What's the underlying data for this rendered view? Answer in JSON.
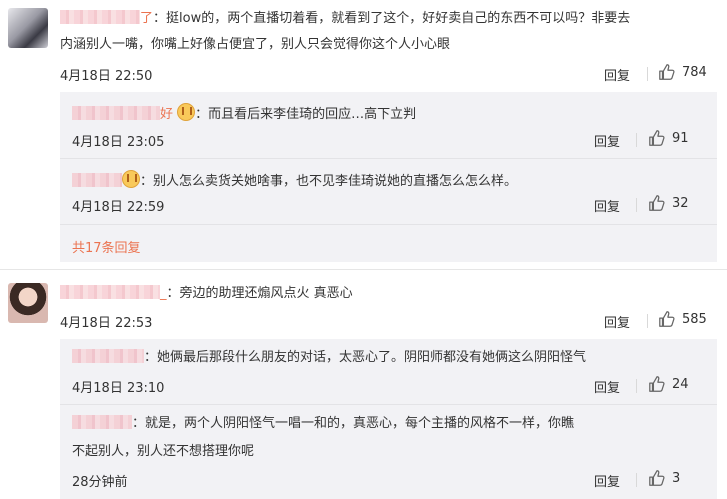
{
  "comments": [
    {
      "text_line1": "挺low的，两个直播切着看，就看到了这个，好好卖自己的东西不可以吗？非要去",
      "text_line2": "内涵别人一嘴，你嘴上好像占便宜了，别人只会觉得你这个人小心眼",
      "name_suffix": "了",
      "time": "4月18日 22:50",
      "reply_label": "回复",
      "likes": "784"
    },
    {
      "text_line1": "旁边的助理还煽风点火 真恶心",
      "name_suffix": "_",
      "time": "4月18日 22:53",
      "reply_label": "回复",
      "likes": "585"
    }
  ],
  "replies1": [
    {
      "name_suffix": "好",
      "text": "而且看后来李佳琦的回应…高下立判",
      "time": "4月18日 23:05",
      "reply_label": "回复",
      "likes": "91"
    },
    {
      "text": "别人怎么卖货关她啥事，也不见李佳琦说她的直播怎么怎么样。",
      "time": "4月18日 22:59",
      "reply_label": "回复",
      "likes": "32"
    }
  ],
  "more_replies": "共17条回复",
  "replies2": [
    {
      "text": "她俩最后那段什么朋友的对话，太恶心了。阴阳师都没有她俩这么阴阳怪气",
      "time": "4月18日 23:10",
      "reply_label": "回复",
      "likes": "24"
    },
    {
      "text_line1": "就是，两个人阴阳怪气一唱一和的，真恶心，每个主播的风格不一样，你瞧",
      "text_line2": "不起别人，别人还不想搭理你呢",
      "time": "28分钟前",
      "reply_label": "回复",
      "likes": "3"
    }
  ]
}
